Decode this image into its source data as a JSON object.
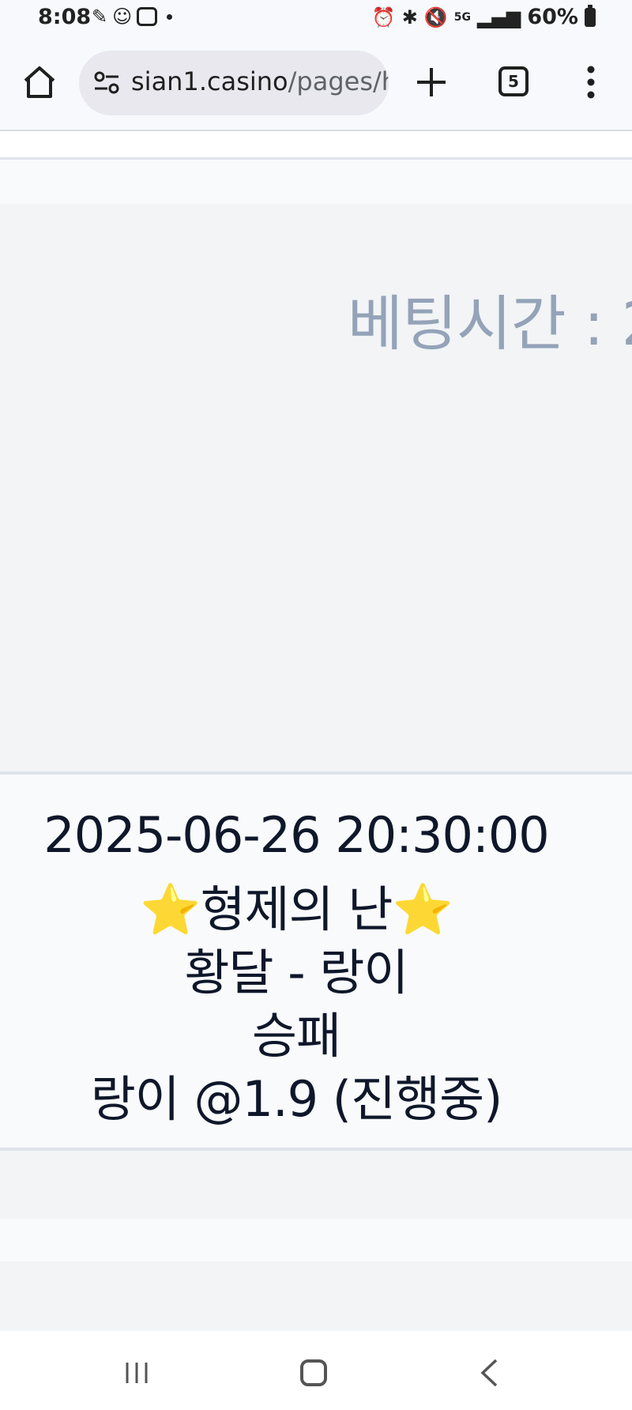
{
  "status_bar": {
    "time": "8:08",
    "left_icons": [
      "app-icon",
      "location-face-icon",
      "message-box-icon",
      "dot-icon"
    ],
    "right_icons": [
      "alarm-icon",
      "bluetooth-icon",
      "mute-icon",
      "5g-icon",
      "signal-icon"
    ],
    "network": "5G",
    "battery": "60%"
  },
  "browser": {
    "url_host": "sian1.casino",
    "url_path": "/pages/h",
    "tab_count": "5"
  },
  "bet": {
    "betting_time_label": "베팅시간 : 2"
  },
  "match": {
    "datetime": "2025-06-26 20:30:00",
    "title_star_left": "⭐",
    "title": "형제의 난",
    "title_star_right": "⭐",
    "teams": "황달 - 랑이",
    "market": "승패",
    "pick": "랑이 @1.9 (진행중)"
  }
}
